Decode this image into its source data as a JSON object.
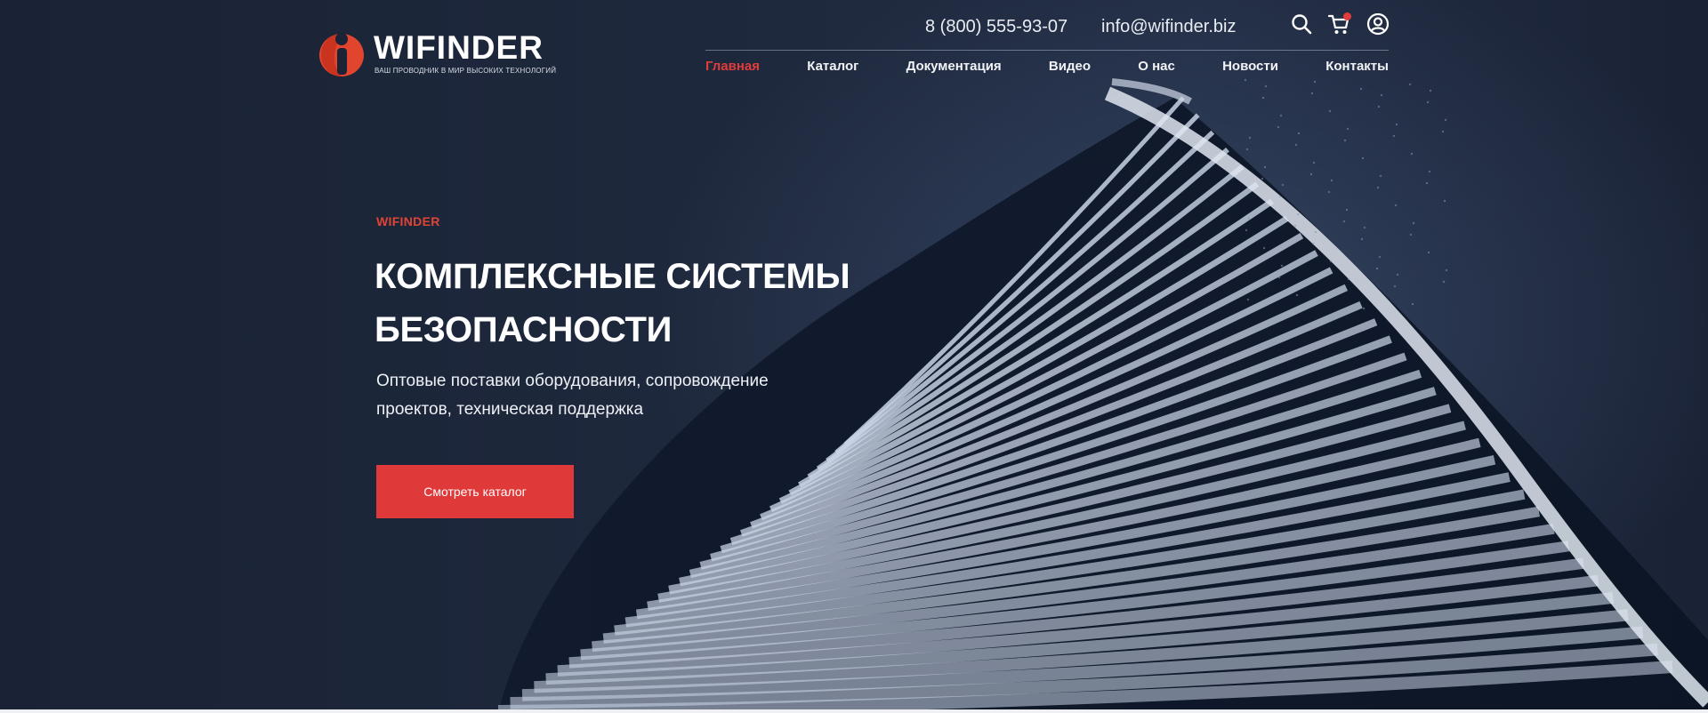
{
  "colors": {
    "accent": "#e0393a",
    "background": "#1b2436",
    "text": "#ffffff"
  },
  "header": {
    "logo": {
      "name": "WIFINDER",
      "tagline": "ВАШ ПРОВОДНИК В МИР ВЫСОКИХ ТЕХНОЛОГИЙ",
      "mark_icon": "logo-i-icon"
    },
    "phone": "8 (800) 555-93-07",
    "email": "info@wifinder.biz",
    "icons": [
      "search-icon",
      "cart-icon",
      "user-icon"
    ],
    "nav": [
      {
        "label": "Главная",
        "active": true
      },
      {
        "label": "Каталог",
        "active": false
      },
      {
        "label": "Документация",
        "active": false
      },
      {
        "label": "Видео",
        "active": false
      },
      {
        "label": "О нас",
        "active": false
      },
      {
        "label": "Новости",
        "active": false
      },
      {
        "label": "Контакты",
        "active": false
      }
    ]
  },
  "hero": {
    "kicker": "WIFINDER",
    "headline_line1": "КОМПЛЕКСНЫЕ СИСТЕМЫ",
    "headline_line2": "БЕЗОПАСНОСТИ",
    "subtext_line1": "Оптовые поставки оборудования, сопровождение",
    "subtext_line2": "проектов, техническая поддержка",
    "cta_label": "Смотреть каталог"
  }
}
